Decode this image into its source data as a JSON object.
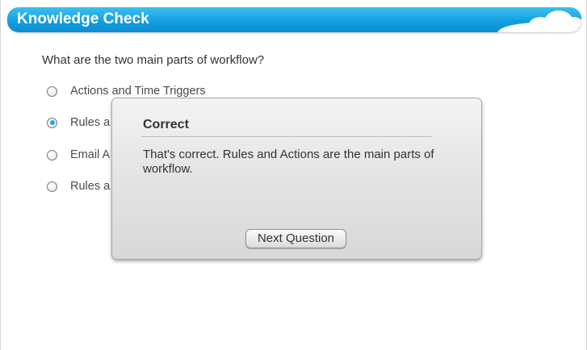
{
  "header": {
    "title": "Knowledge Check",
    "decoration_icon": "cloud-decoration"
  },
  "quiz": {
    "question": "What are the two main parts of workflow?",
    "options": [
      {
        "label": "Actions and Time Triggers",
        "selected": false
      },
      {
        "label": "Rules a",
        "selected": true
      },
      {
        "label": "Email A",
        "selected": false
      },
      {
        "label": "Rules a",
        "selected": false
      }
    ]
  },
  "feedback_dialog": {
    "title": "Correct",
    "message": "That's correct. Rules and Actions are the main parts of workflow.",
    "next_button_label": "Next Question"
  },
  "colors": {
    "header_blue": "#139fe0",
    "radio_selected": "#1ea6dc"
  }
}
